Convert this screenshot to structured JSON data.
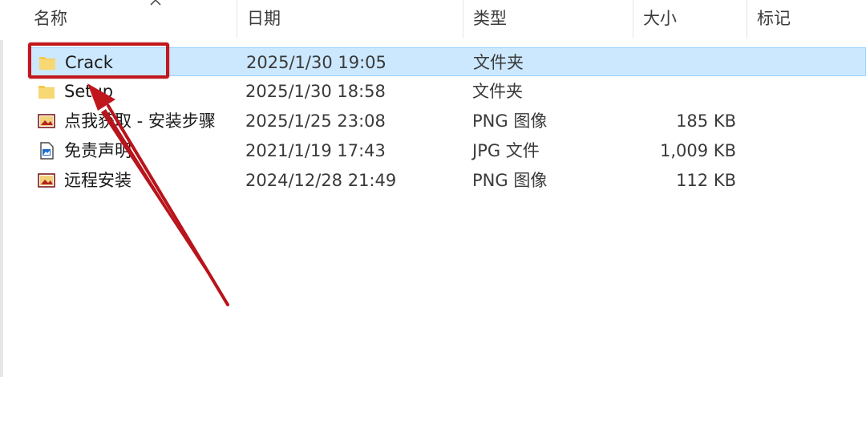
{
  "columns": {
    "name": "名称",
    "date": "日期",
    "type": "类型",
    "size": "大小",
    "tags": "标记"
  },
  "files": [
    {
      "name": "Crack",
      "date": "2025/1/30 19:05",
      "type": "文件夹",
      "size": "",
      "icon": "folder-icon",
      "selected": true
    },
    {
      "name": "Setup",
      "date": "2025/1/30 18:58",
      "type": "文件夹",
      "size": "",
      "icon": "folder-icon",
      "selected": false
    },
    {
      "name": "点我获取 - 安装步骤",
      "date": "2025/1/25 23:08",
      "type": "PNG 图像",
      "size": "185 KB",
      "icon": "png-image-icon",
      "selected": false
    },
    {
      "name": "免责声明",
      "date": "2021/1/19 17:43",
      "type": "JPG 文件",
      "size": "1,009 KB",
      "icon": "jpg-file-icon",
      "selected": false
    },
    {
      "name": "远程安装",
      "date": "2024/12/28 21:49",
      "type": "PNG 图像",
      "size": "112 KB",
      "icon": "png-image-icon",
      "selected": false
    }
  ],
  "colors": {
    "selection_bg": "#cce8ff",
    "selection_border": "#99d1ff",
    "annotation_red": "#c0171d",
    "folder_yellow": "#f8d775"
  }
}
